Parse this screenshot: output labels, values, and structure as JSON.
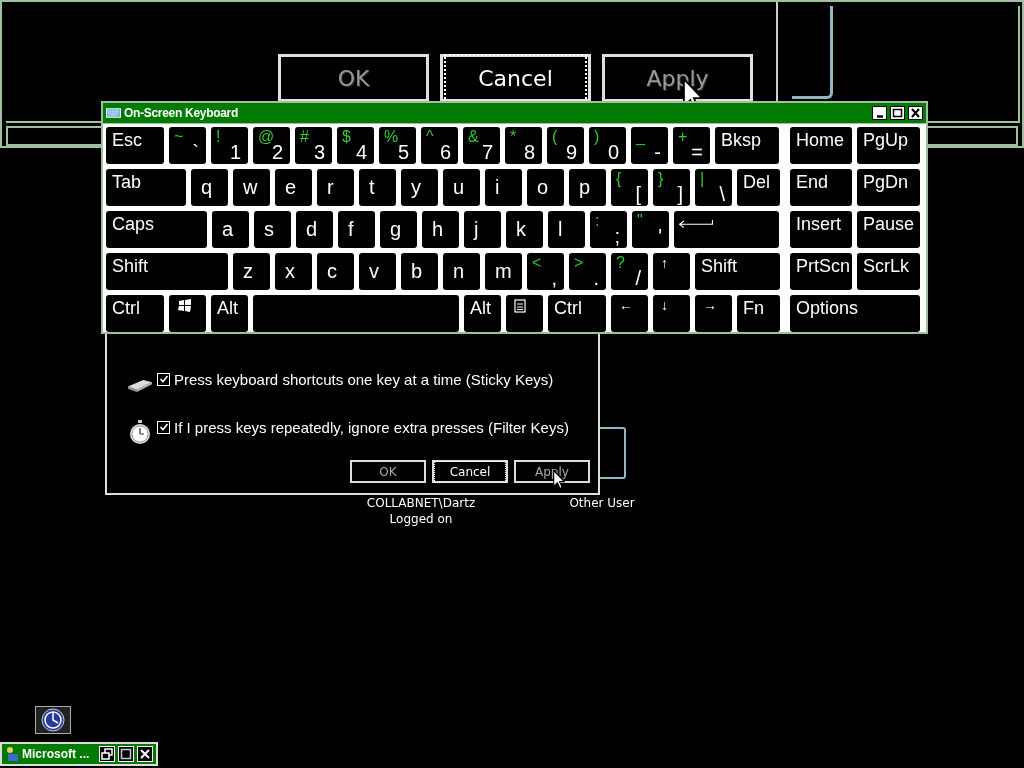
{
  "magnifier": {
    "buttons": [
      {
        "label": "OK",
        "disabled": true,
        "focused": false
      },
      {
        "label": "Cancel",
        "disabled": false,
        "focused": true
      },
      {
        "label": "Apply",
        "disabled": true,
        "focused": false
      }
    ]
  },
  "dialog": {
    "options": [
      {
        "kind": "keyboard",
        "label": "Press keyboard shortcuts one key at a time (Sticky Keys)",
        "checked": true
      },
      {
        "kind": "stopwatch",
        "label": "If I press keys repeatedly, ignore extra presses (Filter Keys)",
        "checked": true
      }
    ],
    "buttons": [
      {
        "label": "OK",
        "disabled": true,
        "focused": false
      },
      {
        "label": "Cancel",
        "disabled": false,
        "focused": true
      },
      {
        "label": "Apply",
        "disabled": true,
        "focused": false
      }
    ]
  },
  "user_tiles": [
    {
      "name": "COLLABNET\\Dartz",
      "status": "Logged on"
    },
    {
      "name": "Other User"
    }
  ],
  "keyboard": {
    "title": "On-Screen Keyboard",
    "main_rows": [
      [
        {
          "kind": "label",
          "label": "Esc"
        },
        {
          "kind": "dual",
          "shift": "~",
          "main": "`"
        },
        {
          "kind": "dual",
          "shift": "!",
          "main": "1"
        },
        {
          "kind": "dual",
          "shift": "@",
          "main": "2"
        },
        {
          "kind": "dual",
          "shift": "#",
          "main": "3"
        },
        {
          "kind": "dual",
          "shift": "$",
          "main": "4"
        },
        {
          "kind": "dual",
          "shift": "%",
          "main": "5"
        },
        {
          "kind": "dual",
          "shift": "^",
          "main": "6"
        },
        {
          "kind": "dual",
          "shift": "&",
          "main": "7"
        },
        {
          "kind": "dual",
          "shift": "*",
          "main": "8"
        },
        {
          "kind": "dual",
          "shift": "(",
          "main": "9"
        },
        {
          "kind": "dual",
          "shift": ")",
          "main": "0"
        },
        {
          "kind": "dual",
          "shift": "_",
          "main": "-"
        },
        {
          "kind": "dual",
          "shift": "+",
          "main": "="
        },
        {
          "kind": "label",
          "label": "Bksp"
        }
      ],
      [
        {
          "kind": "label",
          "label": "Tab"
        },
        {
          "kind": "char",
          "label": "q"
        },
        {
          "kind": "char",
          "label": "w"
        },
        {
          "kind": "char",
          "label": "e"
        },
        {
          "kind": "char",
          "label": "r"
        },
        {
          "kind": "char",
          "label": "t"
        },
        {
          "kind": "char",
          "label": "y"
        },
        {
          "kind": "char",
          "label": "u"
        },
        {
          "kind": "char",
          "label": "i"
        },
        {
          "kind": "char",
          "label": "o"
        },
        {
          "kind": "char",
          "label": "p"
        },
        {
          "kind": "dual",
          "shift": "{",
          "main": "["
        },
        {
          "kind": "dual",
          "shift": "}",
          "main": "]"
        },
        {
          "kind": "dual",
          "shift": "|",
          "main": "\\"
        },
        {
          "kind": "label",
          "label": "Del"
        }
      ],
      [
        {
          "kind": "label",
          "label": "Caps"
        },
        {
          "kind": "char",
          "label": "a"
        },
        {
          "kind": "char",
          "label": "s"
        },
        {
          "kind": "char",
          "label": "d"
        },
        {
          "kind": "char",
          "label": "f"
        },
        {
          "kind": "char",
          "label": "g"
        },
        {
          "kind": "char",
          "label": "h"
        },
        {
          "kind": "char",
          "label": "j"
        },
        {
          "kind": "char",
          "label": "k"
        },
        {
          "kind": "char",
          "label": "l"
        },
        {
          "kind": "dual",
          "shift": ":",
          "main": ";"
        },
        {
          "kind": "dual",
          "shift": "\"",
          "main": "'"
        },
        {
          "kind": "enter"
        }
      ],
      [
        {
          "kind": "label",
          "label": "Shift"
        },
        {
          "kind": "char",
          "label": "z"
        },
        {
          "kind": "char",
          "label": "x"
        },
        {
          "kind": "char",
          "label": "c"
        },
        {
          "kind": "char",
          "label": "v"
        },
        {
          "kind": "char",
          "label": "b"
        },
        {
          "kind": "char",
          "label": "n"
        },
        {
          "kind": "char",
          "label": "m"
        },
        {
          "kind": "dual",
          "shift": "<",
          "main": ","
        },
        {
          "kind": "dual",
          "shift": ">",
          "main": "."
        },
        {
          "kind": "dual",
          "shift": "?",
          "main": "/"
        },
        {
          "kind": "arrow",
          "label": "↑"
        },
        {
          "kind": "label",
          "label": "Shift"
        }
      ],
      [
        {
          "kind": "label",
          "label": "Ctrl"
        },
        {
          "kind": "windows"
        },
        {
          "kind": "label",
          "label": "Alt"
        },
        {
          "kind": "space"
        },
        {
          "kind": "label",
          "label": "Alt"
        },
        {
          "kind": "menu"
        },
        {
          "kind": "label",
          "label": "Ctrl"
        },
        {
          "kind": "arrow",
          "label": "←"
        },
        {
          "kind": "arrow",
          "label": "↓"
        },
        {
          "kind": "arrow",
          "label": "→"
        },
        {
          "kind": "label",
          "label": "Fn"
        }
      ]
    ],
    "nav_rows": [
      [
        "Home",
        "PgUp"
      ],
      [
        "End",
        "PgDn"
      ],
      [
        "Insert",
        "Pause"
      ],
      [
        "PrtScn",
        "ScrLk"
      ],
      [
        "Options"
      ]
    ]
  },
  "taskbar": {
    "items": [
      {
        "label": "Microsoft ..."
      }
    ]
  }
}
